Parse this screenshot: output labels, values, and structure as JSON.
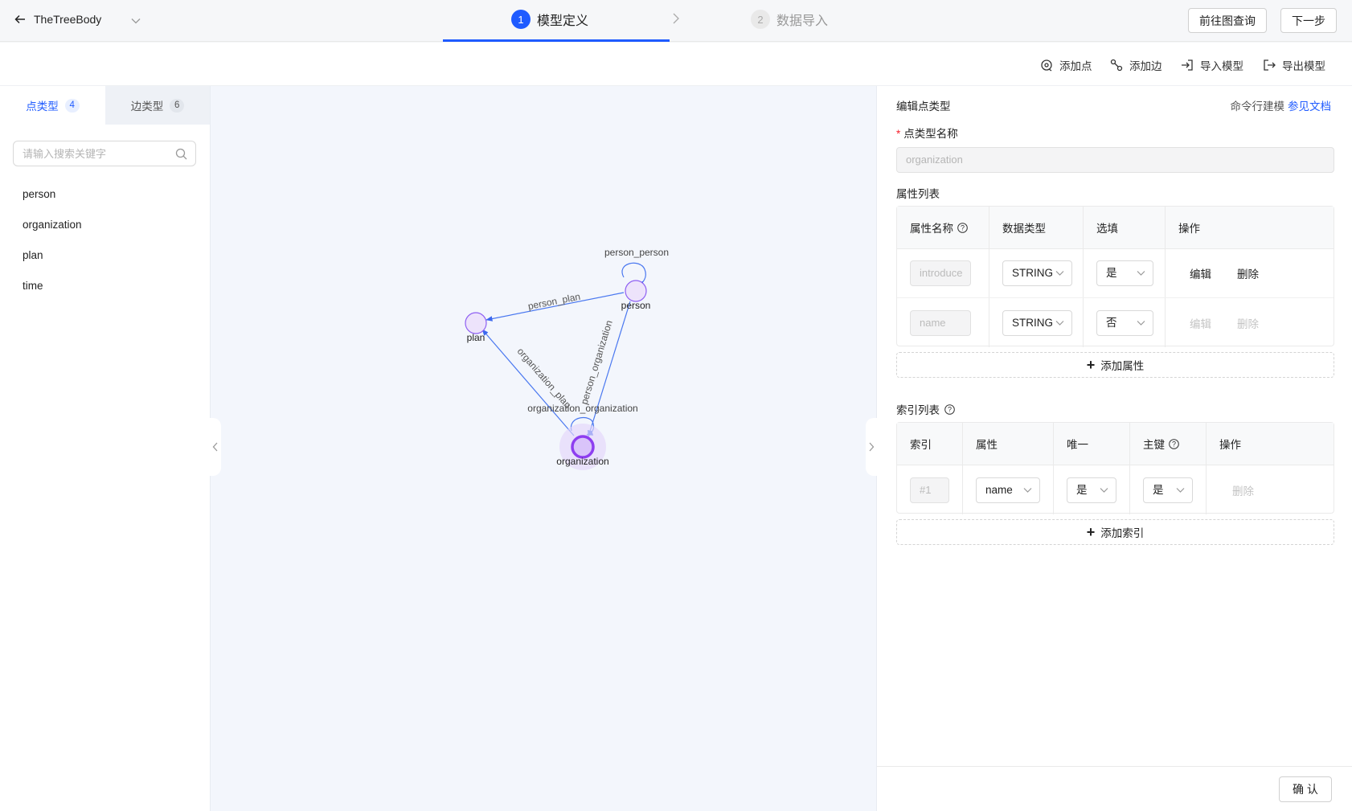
{
  "header": {
    "project_name": "TheTreeBody",
    "steps": [
      {
        "num": "1",
        "label": "模型定义"
      },
      {
        "num": "2",
        "label": "数据导入"
      }
    ],
    "query_button": "前往图查询",
    "next_button": "下一步"
  },
  "toolbar": {
    "add_vertex": "添加点",
    "add_edge": "添加边",
    "import_model": "导入模型",
    "export_model": "导出模型"
  },
  "left_panel": {
    "tabs": [
      {
        "label": "点类型",
        "count": "4"
      },
      {
        "label": "边类型",
        "count": "6"
      }
    ],
    "search_placeholder": "请输入搜索关键字",
    "types": [
      "person",
      "organization",
      "plan",
      "time"
    ]
  },
  "graph": {
    "nodes": [
      {
        "id": "person",
        "label": "person"
      },
      {
        "id": "plan",
        "label": "plan"
      },
      {
        "id": "organization",
        "label": "organization",
        "selected": true
      }
    ],
    "edges": [
      {
        "source": "person",
        "target": "person",
        "label": "person_person"
      },
      {
        "source": "person",
        "target": "plan",
        "label": "person_plan"
      },
      {
        "source": "person",
        "target": "organization",
        "label": "person_organization"
      },
      {
        "source": "organization",
        "target": "plan",
        "label": "organization_plan"
      },
      {
        "source": "organization",
        "target": "organization",
        "label": "organization_organization"
      }
    ],
    "colors": {
      "edge": "#4a78f0",
      "node_fill": "#ede3fb",
      "node_stroke": "#8e5ff2",
      "selected": "#8e3ef0"
    }
  },
  "right_panel": {
    "title": "编辑点类型",
    "cmd_text": "命令行建模",
    "doc_link": "参见文档",
    "name_label": "点类型名称",
    "name_value": "organization",
    "attr_section": "属性列表",
    "attr_headers": [
      "属性名称",
      "数据类型",
      "选填",
      "操作"
    ],
    "attrs": [
      {
        "name": "introduce",
        "type": "STRING",
        "optional": "是",
        "edit": "编辑",
        "delete": "删除"
      },
      {
        "name": "name",
        "type": "STRING",
        "optional": "否",
        "edit": "编辑",
        "delete": "删除"
      }
    ],
    "add_attr": "添加属性",
    "index_section": "索引列表",
    "index_headers": [
      "索引",
      "属性",
      "唯一",
      "主键",
      "操作"
    ],
    "indexes": [
      {
        "index": "#1",
        "attr": "name",
        "unique": "是",
        "primary": "是",
        "delete": "删除"
      }
    ],
    "add_index": "添加索引",
    "confirm": "确 认"
  }
}
